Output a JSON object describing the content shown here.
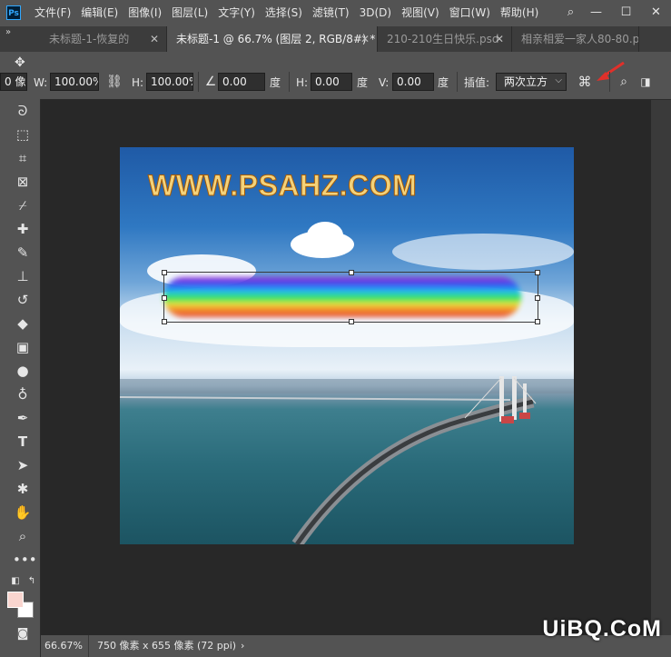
{
  "menubar": {
    "items": [
      "文件(F)",
      "编辑(E)",
      "图像(I)",
      "图层(L)",
      "文字(Y)",
      "选择(S)",
      "滤镜(T)",
      "3D(D)",
      "视图(V)",
      "窗口(W)",
      "帮助(H)"
    ],
    "logo": "Ps"
  },
  "tabs": [
    {
      "label": "未标题-1-恢复的",
      "active": false
    },
    {
      "label": "未标题-1 @ 66.7% (图层 2, RGB/8#) *",
      "active": true
    },
    {
      "label": "210-210生日快乐.psd",
      "active": false
    },
    {
      "label": "相亲相爱一家人80-80.p",
      "active": false
    }
  ],
  "options": {
    "ref_value": "0 像",
    "w_label": "W:",
    "w_value": "100.00%",
    "h_label": "H:",
    "h_value": "100.00%",
    "angle_value": "0.00",
    "angle_unit": "度",
    "hskew_label": "H:",
    "hskew_value": "0.00",
    "hskew_unit": "度",
    "vskew_label": "V:",
    "vskew_value": "0.00",
    "vskew_unit": "度",
    "interp_label": "插值:",
    "interp_value": "两次立方"
  },
  "canvas": {
    "watermark": "WWW.PSAHZ.COM"
  },
  "status": {
    "zoom": "66.67%",
    "doc_info": "750 像素 x 655 像素 (72 ppi)",
    "arrow": "›"
  },
  "site_watermark": "UiBQ.CoM",
  "colors": {
    "foreground": "#f9d5cf",
    "background": "#ffffff",
    "chrome": "#535353",
    "canvas_bg": "#282828"
  }
}
